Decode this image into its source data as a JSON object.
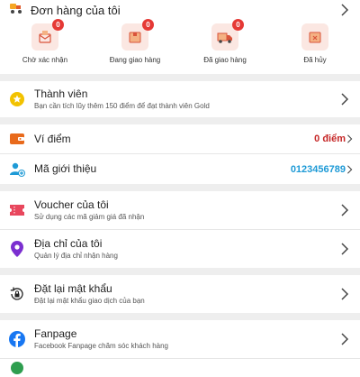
{
  "orders": {
    "title": "Đơn hàng của tôi",
    "items": [
      {
        "label": "Chờ xác nhận",
        "count": "0"
      },
      {
        "label": "Đang giao hàng",
        "count": "0"
      },
      {
        "label": "Đã giao hàng",
        "count": "0"
      },
      {
        "label": "Đã hủy",
        "count": ""
      }
    ]
  },
  "member": {
    "title": "Thành viên",
    "subtitle": "Bạn cần tích lũy thêm 150 điểm để đạt thành viên Gold"
  },
  "wallet": {
    "title": "Ví điểm",
    "value": "0 điểm",
    "value_color": "#c62828"
  },
  "referral": {
    "title": "Mã giới thiệu",
    "value": "0123456789",
    "value_color": "#1e9ad6"
  },
  "voucher": {
    "title": "Voucher của tôi",
    "subtitle": "Sử dụng các mã giảm giá đã nhận"
  },
  "address": {
    "title": "Địa chỉ của tôi",
    "subtitle": "Quản lý địa chỉ nhận hàng"
  },
  "password": {
    "title": "Đặt lại mật khẩu",
    "subtitle": "Đặt lại mật khẩu giao dịch của bạn"
  },
  "fanpage": {
    "title": "Fanpage",
    "subtitle": "Facebook Fanpage chăm sóc khách hàng"
  },
  "icons": {
    "orders": "delivery-scooter-icon",
    "member": "star-icon",
    "wallet": "wallet-icon",
    "referral": "add-user-icon",
    "voucher": "ticket-icon",
    "address": "location-pin-icon",
    "password": "lock-reset-icon",
    "fanpage": "facebook-icon"
  }
}
